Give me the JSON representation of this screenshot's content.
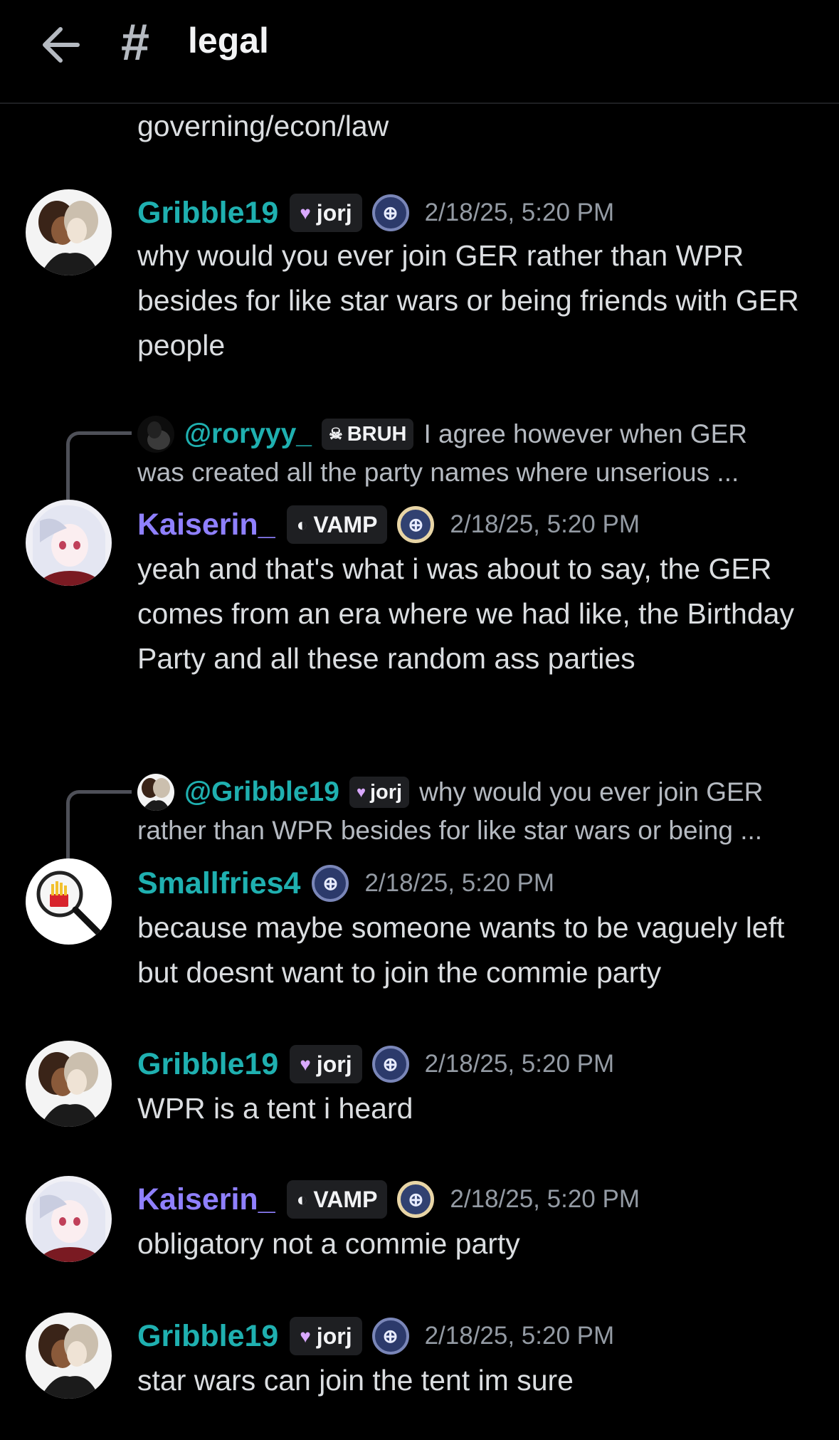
{
  "header": {
    "channel_icon": "#",
    "channel_name": "legal"
  },
  "top_fragment": "governing/econ/law",
  "messages": [
    {
      "username": "Gribble19",
      "tag": "jorj",
      "timestamp": "2/18/25, 5:20 PM",
      "text": "why would you ever join GER rather than WPR besides for like star wars or being friends with GER people"
    },
    {
      "reply": {
        "name": "@roryyy_",
        "tag": "BRUH",
        "snippet_line1": "I agree however when GER",
        "snippet_line2": "was created all the party names where unserious ..."
      },
      "username": "Kaiserin_",
      "tag": "VAMP",
      "timestamp": "2/18/25, 5:20 PM",
      "text": "yeah and that's what i was about to say, the GER comes from an era where we had like, the Birthday Party and all these random ass parties"
    },
    {
      "reply": {
        "name": "@Gribble19",
        "tag": "jorj",
        "snippet_line1": "why would you ever join GER",
        "snippet_line2": "rather than WPR besides for like star wars or being ..."
      },
      "username": "Smallfries4",
      "timestamp": "2/18/25, 5:20 PM",
      "text": "because maybe someone wants to be vaguely left but doesnt want to join the commie party"
    },
    {
      "username": "Gribble19",
      "tag": "jorj",
      "timestamp": "2/18/25, 5:20 PM",
      "text": "WPR is a tent i heard"
    },
    {
      "username": "Kaiserin_",
      "tag": "VAMP",
      "timestamp": "2/18/25, 5:20 PM",
      "text": "obligatory not a commie party"
    },
    {
      "username": "Gribble19",
      "tag": "jorj",
      "timestamp": "2/18/25, 5:20 PM",
      "text": "star wars can join the tent im sure"
    }
  ],
  "icons": {
    "back": "arrow-left-icon",
    "heart": "heart-icon",
    "skull": "skull-icon",
    "moon": "moon-icon",
    "badge": "server-badge-icon"
  },
  "colors": {
    "teal_name": "#1fb0b0",
    "purple_name": "#8f80ff",
    "background": "#000000",
    "text": "#dbdee1"
  }
}
